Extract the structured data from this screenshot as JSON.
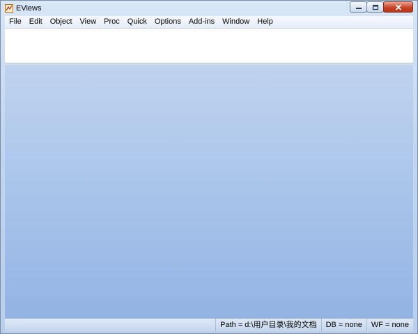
{
  "window": {
    "title": "EViews",
    "icon": "eviews-app-icon",
    "caption_buttons": [
      "minimize-icon",
      "restore-icon",
      "close-icon"
    ]
  },
  "menu": {
    "items": [
      "File",
      "Edit",
      "Object",
      "View",
      "Proc",
      "Quick",
      "Options",
      "Add-ins",
      "Window",
      "Help"
    ]
  },
  "command": {
    "value": ""
  },
  "status": {
    "path": "Path = d:\\用户目录\\我的文档",
    "db": "DB = none",
    "wf": "WF = none"
  }
}
